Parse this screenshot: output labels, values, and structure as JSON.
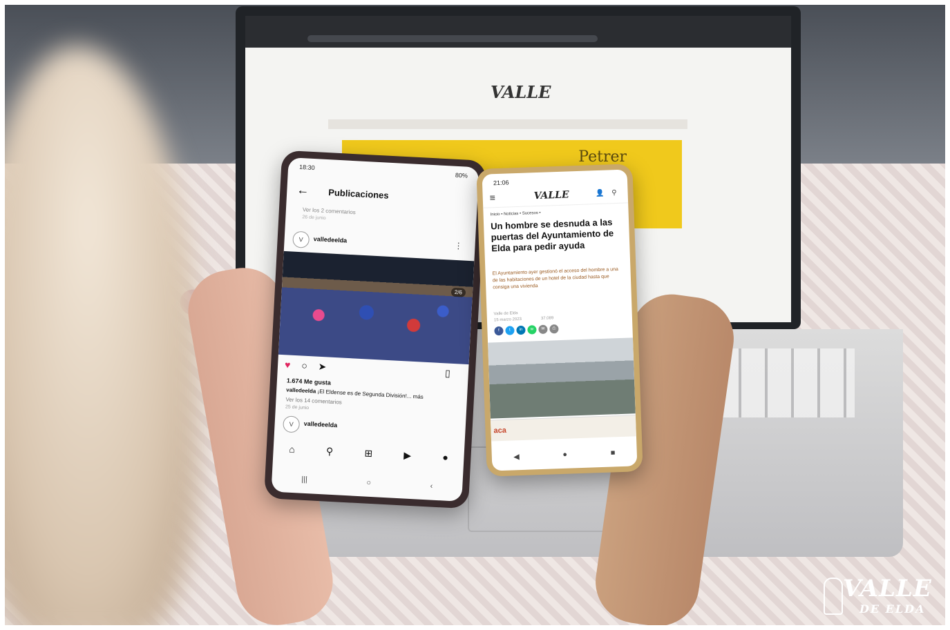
{
  "laptop": {
    "banner_text": "Petrer"
  },
  "phone_instagram": {
    "time": "18:30",
    "battery": "80%",
    "title": "Publicaciones",
    "prev_comments": "Ver los 2 comentarios",
    "prev_date": "26 de junio",
    "account": "valledeelda",
    "photo_counter": "2/6",
    "likes": "1.674 Me gusta",
    "caption_user": "valledeelda",
    "caption_text": "¡El Eldense es de Segunda División!... más",
    "comments": "Ver los 14 comentarios",
    "date": "25 de junio",
    "account2": "valledeelda"
  },
  "phone_news": {
    "time": "21:06",
    "breadcrumb": "Inicio • Noticias • Sucesos •",
    "headline": "Un hombre se desnuda a las puertas del Ayuntamiento de Elda para pedir ayuda",
    "lead": "El Ayuntamiento ayer gestionó el acceso del hombre a una de las habitaciones de un hotel de la ciudad hasta que consiga una vivienda",
    "author": "Valle de Elda",
    "date": "15 marzo 2023",
    "views": "37.089",
    "ad_text": "aca"
  },
  "watermark": {
    "main": "VALLE",
    "sub": "DE ELDA"
  },
  "colors": {
    "banner_yellow": "#f0c91c",
    "heart": "#e0245e",
    "headline": "#111111",
    "lead": "#9a5a20"
  }
}
